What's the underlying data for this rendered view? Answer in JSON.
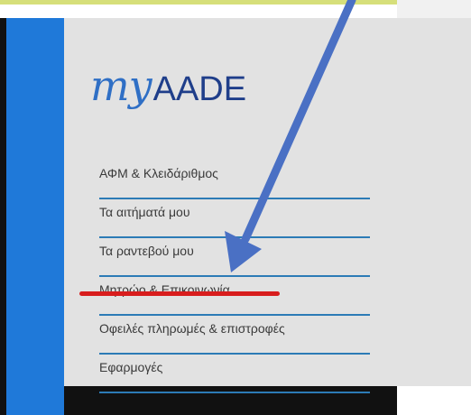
{
  "logo": {
    "my": "my",
    "aade": "AADE"
  },
  "menu": {
    "items": [
      {
        "label": "ΑΦΜ & Κλειδάριθμος"
      },
      {
        "label": "Τα αιτήματά μου"
      },
      {
        "label": "Τα ραντεβού μου"
      },
      {
        "label": "Μητρώο & Επικοινωνία"
      },
      {
        "label": "Οφειλές πληρωμές & επιστροφές"
      },
      {
        "label": "Εφαρμογές"
      }
    ]
  },
  "colors": {
    "sidebar_blue": "#1f79d9",
    "menu_line": "#2c7bb6",
    "annotation_arrow": "#4a70c4",
    "annotation_underline": "#d81d1d"
  }
}
